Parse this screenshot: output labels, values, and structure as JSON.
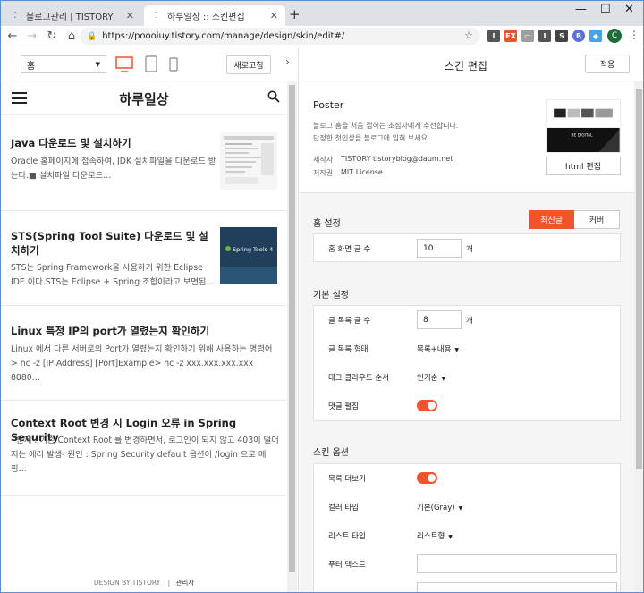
{
  "browser": {
    "tabs": [
      {
        "title": "블로그관리 | TISTORY",
        "active": false
      },
      {
        "title": "하루일상 :: 스킨편집",
        "active": true
      }
    ],
    "url": "https://poooiuy.tistory.com/manage/design/skin/edit#/",
    "profile_initial": "C",
    "extensions": [
      {
        "label": "I",
        "color": "#555555"
      },
      {
        "label": "EX",
        "color": "#e4572e"
      },
      {
        "label": "▭",
        "color": "#9e9e9e"
      },
      {
        "label": "I",
        "color": "#555555"
      },
      {
        "label": "S",
        "color": "#444444"
      },
      {
        "label": "B",
        "color": "#5b6ee1"
      },
      {
        "label": "◆",
        "color": "#4aa3df"
      }
    ]
  },
  "preview_toolbar": {
    "page_select": "홈",
    "refresh_label": "새로고침"
  },
  "preview": {
    "blog_title": "하루일상",
    "posts": [
      {
        "title": "Java 다운로드 및 설치하기",
        "desc": "Oracle 홈페이지에 접속하여, JDK 설치파일을 다운로드 받는다.■ 설치파일 다운로드…"
      },
      {
        "title": "STS(Spring Tool Suite) 다운로드 및 설치하기",
        "desc": "STS는 Spring Framework을 사용하기 위한 Eclipse IDE 이다.STS는 Eclipse + Spring 조합이라고 보면된…",
        "thumb_text": "Spring Tools 4"
      },
      {
        "title": "Linux 특정 IP의 port가 열렸는지 확인하기",
        "desc": "Linux 에서 다른 서버로의 Port가 열렸는지 확인하기 위해 사용하는 명령어 > nc -z [IP Address] [Port]Example> nc -z xxx.xxx.xxx.xxx 8080…"
      },
      {
        "title": "Context Root 변경 시 Login 오류 in Spring Security",
        "desc": "- 문제 : 기존 Context Root 를 변경하면서, 로그인이 되지 않고 403이 떨어지는 에러 발생- 원인 : Spring Security default 옵션이 /login 으로 매핑…"
      }
    ],
    "footer_design": "DESIGN BY TISTORY",
    "footer_sep": "|",
    "footer_admin": "관리자"
  },
  "panel": {
    "title": "스킨 편집",
    "apply_label": "적용",
    "skin": {
      "name": "Poster",
      "desc_line1": "블로그 홈을 처음 접하는 초심자에게 추천합니다.",
      "desc_line2": "단정한 첫인상을 블로그에 입혀 보세요.",
      "maker_label": "제작자",
      "maker_value": "TISTORY tistoryblog@daum.net",
      "license_label": "저작권",
      "license_value": "MIT License",
      "thumb_text": "BE DIGITAL",
      "html_edit_label": "html 편집"
    },
    "home_settings": {
      "title": "홈 설정",
      "seg_latest": "최신글",
      "seg_cover": "커버",
      "posts_count_label": "홈 화면 글 수",
      "posts_count_value": "10",
      "unit": "개"
    },
    "basic_settings": {
      "title": "기본 설정",
      "list_count_label": "글 목록 글 수",
      "list_count_value": "8",
      "unit": "개",
      "list_type_label": "글 목록 형태",
      "list_type_value": "목록+내용",
      "tag_order_label": "태그 클라우드 순서",
      "tag_order_value": "인기순",
      "comment_expand_label": "댓글 펼침",
      "comment_expand_on": true
    },
    "skin_options": {
      "title": "스킨 옵션",
      "more_list_label": "목록 더보기",
      "more_list_on": true,
      "color_type_label": "컬러 타입",
      "color_type_value": "기본(Gray)",
      "list_type_label": "리스트 타입",
      "list_type_value": "리스트형",
      "footer_text_label": "푸터 텍스트"
    }
  },
  "colors": {
    "accent": "#f0542f",
    "panel_bg": "#f5f5f5",
    "tab_strip": "#dee1e6",
    "preview_icon_active": "#f0542f"
  }
}
